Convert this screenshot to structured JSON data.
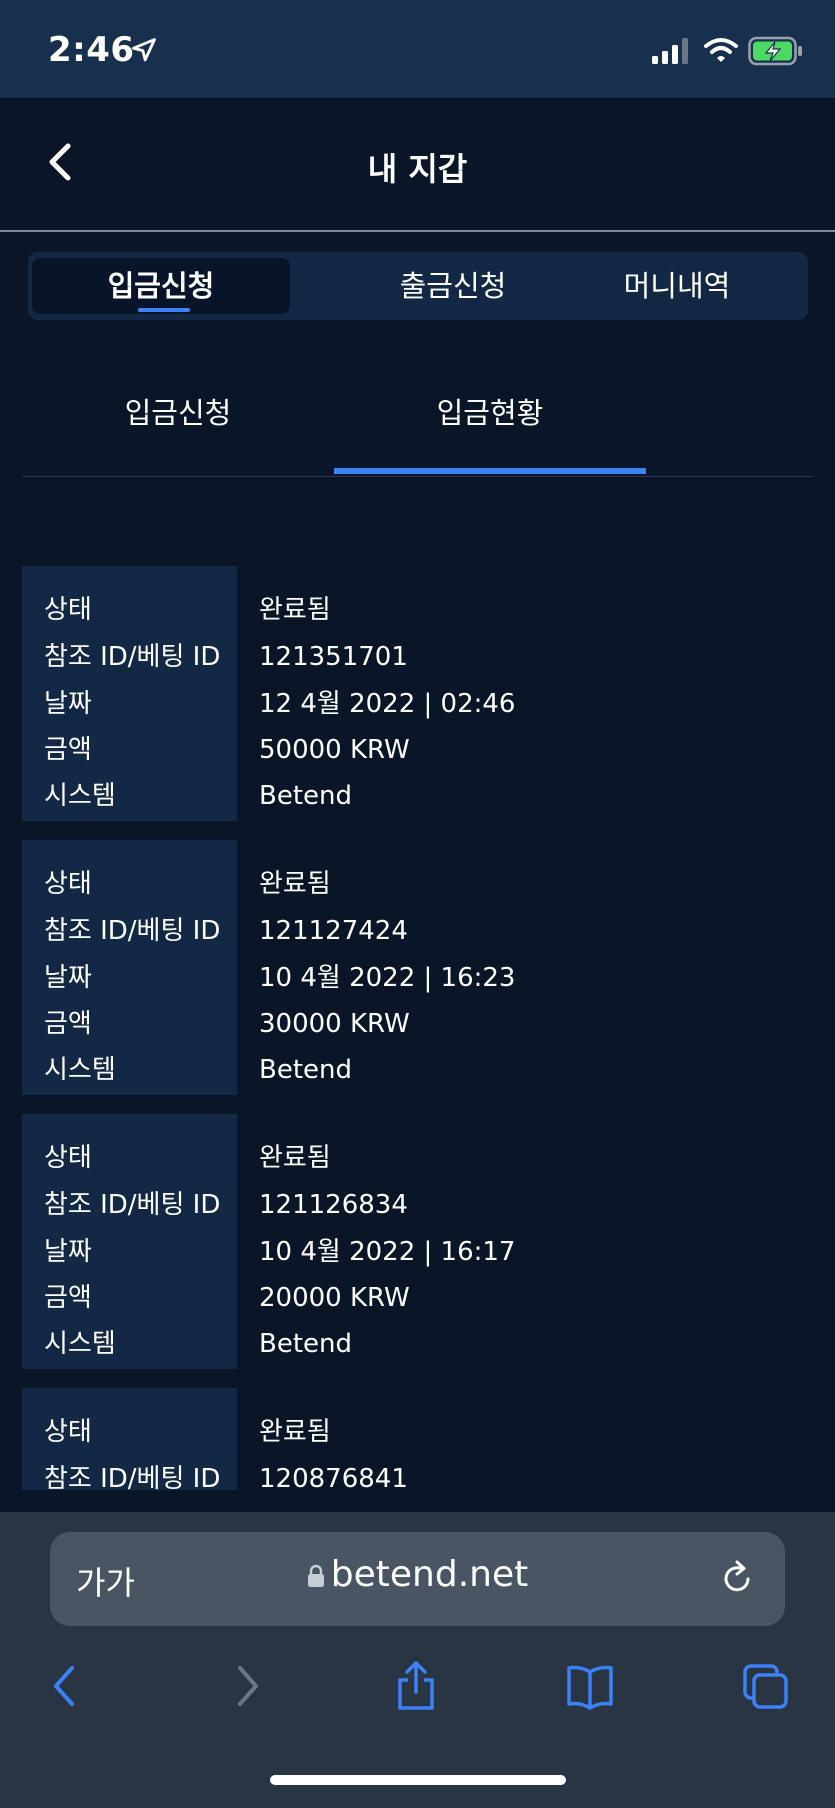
{
  "status_bar": {
    "time": "2:46"
  },
  "header": {
    "title": "내 지갑"
  },
  "main_tabs": [
    {
      "label": "입금신청"
    },
    {
      "label": "출금신청"
    },
    {
      "label": "머니내역"
    }
  ],
  "sub_tabs": [
    {
      "label": "입금신청"
    },
    {
      "label": "입금현황"
    }
  ],
  "record_labels": {
    "status": "상태",
    "ref_id": "참조 ID/베팅 ID",
    "date": "날짜",
    "amount": "금액",
    "system": "시스템"
  },
  "records": [
    {
      "status": "완료됨",
      "ref_id": "121351701",
      "date": "12 4월 2022 | 02:46",
      "amount": "50000 KRW",
      "system": "Betend"
    },
    {
      "status": "완료됨",
      "ref_id": "121127424",
      "date": "10 4월 2022 | 16:23",
      "amount": "30000 KRW",
      "system": "Betend"
    },
    {
      "status": "완료됨",
      "ref_id": "121126834",
      "date": "10 4월 2022 | 16:17",
      "amount": "20000 KRW",
      "system": "Betend"
    },
    {
      "status": "완료됨",
      "ref_id": "120876841",
      "date": "",
      "amount": "",
      "system": ""
    }
  ],
  "browser": {
    "text_size_label": "가가",
    "url": "betend.net"
  },
  "colors": {
    "background": "#0a1628",
    "status_bar": "#16304d",
    "panel": "#132844",
    "accent": "#3b82f6",
    "safari_bar": "#2a3544"
  }
}
